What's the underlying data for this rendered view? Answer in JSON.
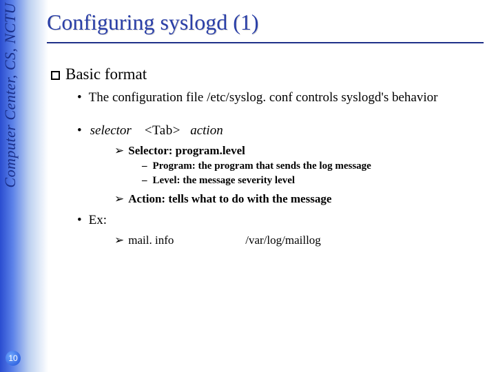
{
  "sidebar": {
    "org_text": "Computer Center, CS, NCTU"
  },
  "page_number": "10",
  "title": "Configuring syslogd (1)",
  "body": {
    "basic_format": "Basic format",
    "config_line": "The configuration file /etc/syslog. conf controls syslogd's behavior",
    "selector_word": "selector",
    "tab_sep": "<Tab>",
    "action_word": "action",
    "selector_heading": "Selector:  program.level",
    "program_line": "Program: the program that sends the log message",
    "level_line": "Level: the message severity level",
    "action_heading": "Action: tells what to do with the message",
    "ex_label": "Ex:",
    "ex_selector": "mail. info",
    "ex_action": "/var/log/maillog"
  }
}
